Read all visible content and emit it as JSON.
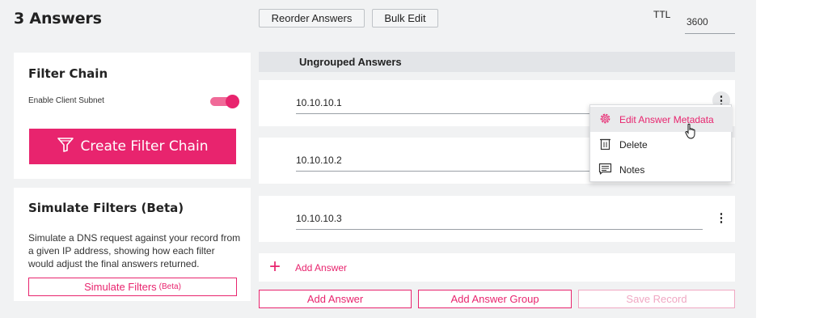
{
  "header": {
    "title": "3 Answers",
    "reorder_label": "Reorder Answers",
    "bulk_edit_label": "Bulk Edit",
    "ttl_label": "TTL",
    "ttl_value": "3600"
  },
  "filter_chain": {
    "title": "Filter Chain",
    "enable_client_subnet_label": "Enable Client Subnet",
    "enable_client_subnet_on": true,
    "create_button_label": "Create Filter Chain"
  },
  "simulate": {
    "title": "Simulate Filters (Beta)",
    "description": "Simulate a DNS request against your record from a given IP address, showing how each filter would adjust the final answers returned.",
    "button_label": "Simulate Filters",
    "button_suffix": "(Beta)"
  },
  "answers": {
    "group_title": "Ungrouped Answers",
    "items": [
      {
        "value": "10.10.10.1"
      },
      {
        "value": "10.10.10.2"
      },
      {
        "value": "10.10.10.3"
      }
    ],
    "add_answer_link": "Add Answer"
  },
  "context_menu": {
    "items": [
      {
        "label": "Edit Answer Metadata",
        "icon": "gear-icon"
      },
      {
        "label": "Delete",
        "icon": "trash-icon"
      },
      {
        "label": "Notes",
        "icon": "notes-icon"
      }
    ]
  },
  "footer": {
    "add_answer_label": "Add Answer",
    "add_group_label": "Add Answer Group",
    "save_label": "Save Record"
  },
  "colors": {
    "accent": "#e8246e",
    "background": "#f1f2f3",
    "disabled_accent": "#f0a8c3"
  }
}
